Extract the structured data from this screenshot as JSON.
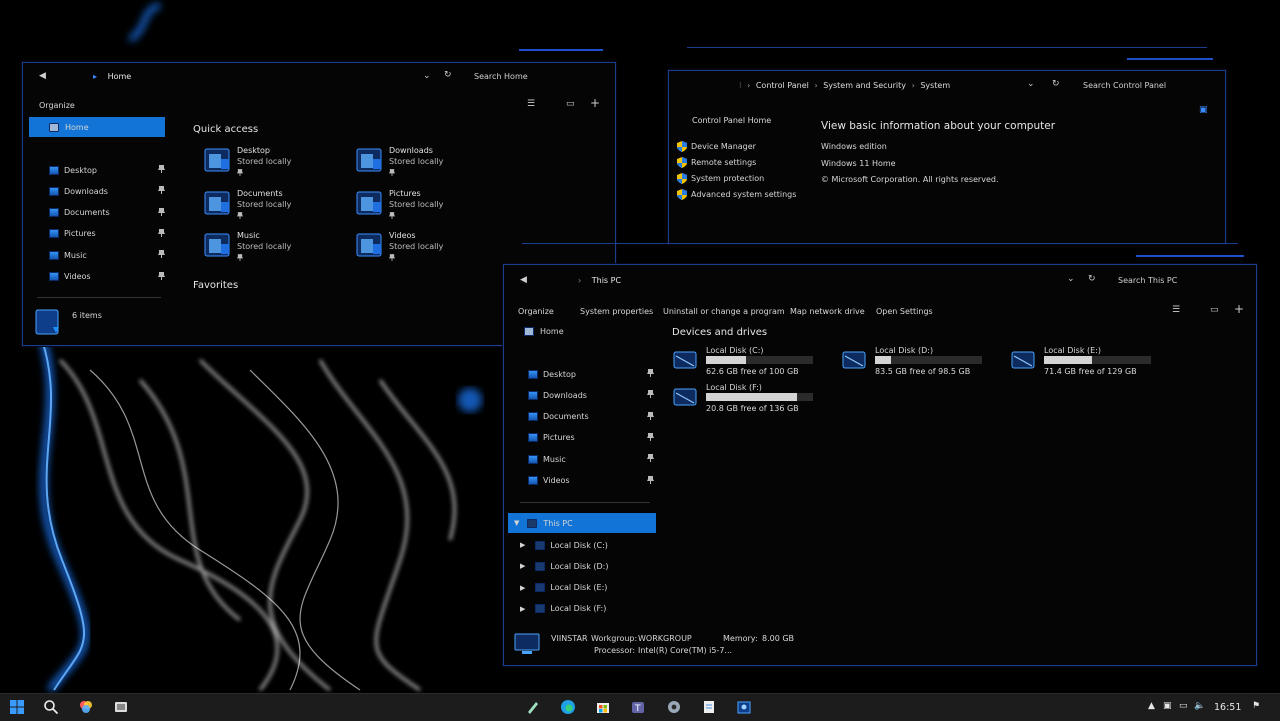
{
  "window1": {
    "breadcrumb": "Home",
    "search_placeholder": "Search Home",
    "toolbar": {
      "organize": "Organize"
    },
    "sidebar": {
      "home": "Home",
      "items": [
        "Desktop",
        "Downloads",
        "Documents",
        "Pictures",
        "Music",
        "Videos"
      ]
    },
    "quick_access": {
      "header": "Quick access",
      "items": [
        {
          "name": "Desktop",
          "sub": "Stored locally"
        },
        {
          "name": "Downloads",
          "sub": "Stored locally"
        },
        {
          "name": "Documents",
          "sub": "Stored locally"
        },
        {
          "name": "Pictures",
          "sub": "Stored locally"
        },
        {
          "name": "Music",
          "sub": "Stored locally"
        },
        {
          "name": "Videos",
          "sub": "Stored locally"
        }
      ]
    },
    "favorites_header": "Favorites",
    "status": "6 items"
  },
  "window2": {
    "breadcrumb": [
      "Control Panel",
      "System and Security",
      "System"
    ],
    "search_placeholder": "Search Control Panel",
    "sidebar": {
      "home": "Control Panel Home",
      "links": [
        "Device Manager",
        "Remote settings",
        "System protection",
        "Advanced system settings"
      ]
    },
    "main": {
      "heading": "View basic information about your computer",
      "edition_label": "Windows edition",
      "edition": "Windows 11 Home",
      "copyright": "© Microsoft Corporation. All rights reserved."
    }
  },
  "window3": {
    "breadcrumb": "This PC",
    "search_placeholder": "Search This PC",
    "toolbar": [
      "Organize",
      "System properties",
      "Uninstall or change a program",
      "Map network drive",
      "Open Settings"
    ],
    "sidebar": {
      "home": "Home",
      "items": [
        "Desktop",
        "Downloads",
        "Documents",
        "Pictures",
        "Music",
        "Videos"
      ],
      "this_pc": "This PC",
      "drives": [
        "Local Disk (C:)",
        "Local Disk (D:)",
        "Local Disk (E:)",
        "Local Disk (F:)"
      ]
    },
    "devices": {
      "header": "Devices and drives",
      "drives": [
        {
          "name": "Local Disk (C:)",
          "free": "62.6 GB free of 100 GB",
          "used_fraction": 0.374
        },
        {
          "name": "Local Disk (D:)",
          "free": "83.5 GB free of 98.5 GB",
          "used_fraction": 0.152
        },
        {
          "name": "Local Disk (E:)",
          "free": "71.4 GB free of 129 GB",
          "used_fraction": 0.447
        },
        {
          "name": "Local Disk (F:)",
          "free": "20.8 GB free of 136 GB",
          "used_fraction": 0.847
        }
      ]
    },
    "details": {
      "computer_name": "VIINSTAR",
      "workgroup_label": "Workgroup:",
      "workgroup": "WORKGROUP",
      "memory_label": "Memory:",
      "memory": "8.00 GB",
      "processor_label": "Processor:",
      "processor": "Intel(R) Core(TM) i5-7..."
    }
  },
  "taskbar": {
    "time": "16:51"
  },
  "colors": {
    "accent": "#1174d6",
    "frame": "#1a3d8f",
    "wallpaper_glow": "#1e7bff"
  }
}
